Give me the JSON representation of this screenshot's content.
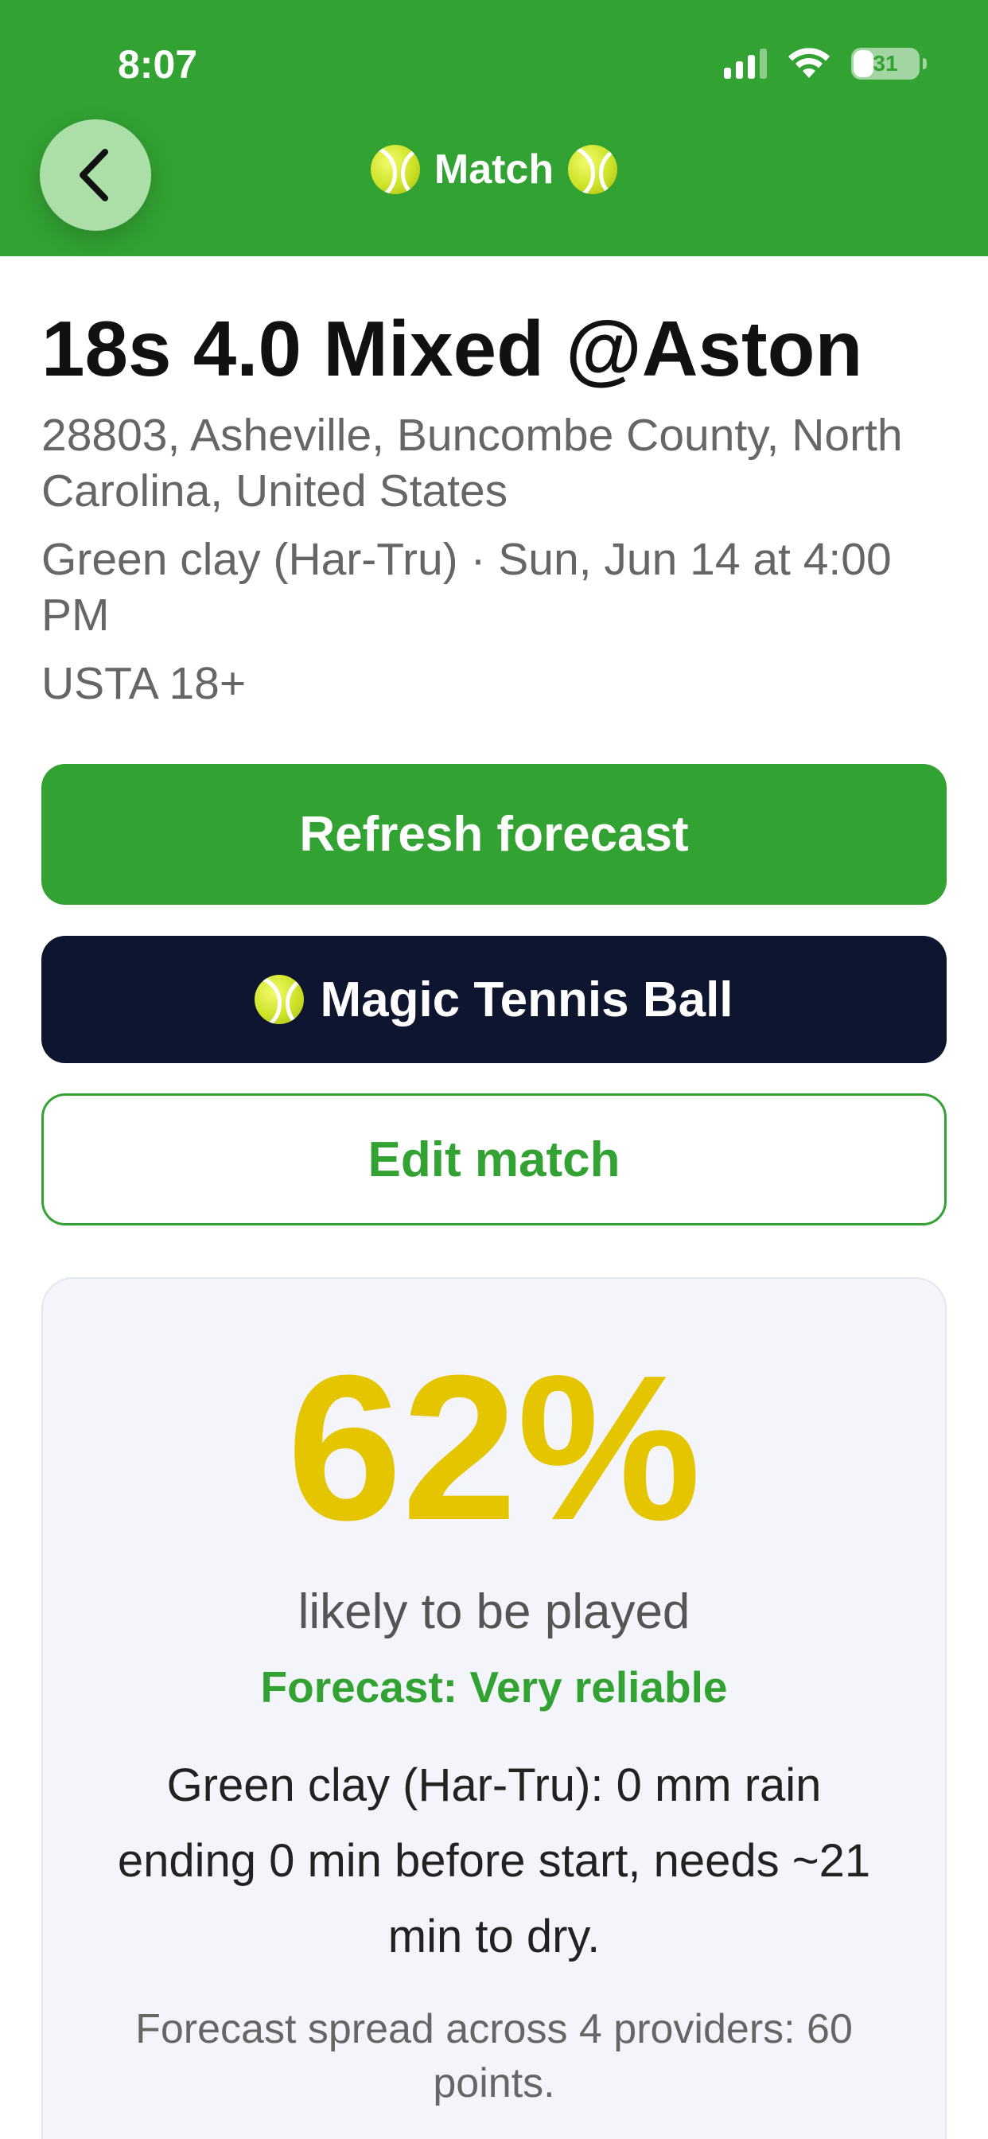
{
  "status_bar": {
    "time": "8:07",
    "battery": "31",
    "battery_level": 0.31,
    "icons": [
      "cellular-signal-icon",
      "wifi-icon",
      "battery-icon"
    ]
  },
  "header": {
    "title": "Match",
    "back_icon": "chevron-left-icon",
    "title_icon": "tennis-ball-icon",
    "background": "#32a232"
  },
  "match": {
    "title": "18s 4.0 Mixed @Aston",
    "location": "28803, Asheville, Buncombe County, North Carolina, United States",
    "surface_and_time": "Green clay (Har-Tru) · Sun, Jun 14 at 4:00 PM",
    "league": "USTA 18+"
  },
  "actions": {
    "refresh_label": "Refresh forecast",
    "magic_label": "Magic Tennis Ball",
    "edit_label": "Edit match"
  },
  "forecast": {
    "percent": "62%",
    "likely_label": "likely to be played",
    "reliability": "Forecast: Very reliable",
    "explanation": "Green clay (Har-Tru): 0 mm rain ending 0 min before start, needs ~21 min to dry.",
    "spread": "Forecast spread across 4 providers: 60 points.",
    "percent_color": "#e5c400",
    "reliability_color": "#32a232"
  },
  "colors": {
    "brand_green": "#32a232",
    "dark_navy": "#0e152e",
    "back_button": "#acdfa8"
  }
}
